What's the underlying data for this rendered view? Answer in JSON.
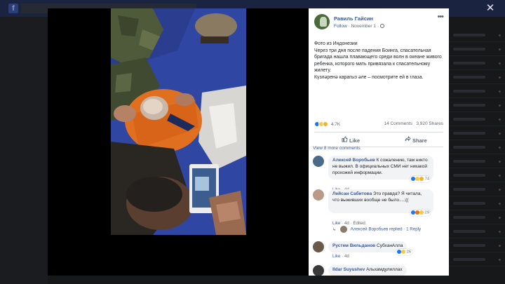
{
  "app": {
    "logo_letter": "f"
  },
  "viewer": {
    "close_glyph": "✕"
  },
  "post": {
    "author": "Равиль Гайсин",
    "follow": "Follow",
    "date": "November 1",
    "separator": "·",
    "more_glyph": "•••",
    "text_lines": [
      "Фото из Индонезии",
      "Через три дня после падения Боинга, спасательная бригада нашла плавающего среди волн в океане живого ребенка, которого мать привязала к спасательному жилету.",
      "Күзләренә карагыз әле – посмотрите ей в глаза."
    ],
    "reactions_count": "4.7K",
    "comments_count": "14 Comments",
    "shares_count": "3,920 Shares",
    "like_label": "Like",
    "share_label": "Share"
  },
  "comments": {
    "view_more": "View 8 more comments",
    "items": [
      {
        "name": "Алексей Воробьев",
        "text": "К сожалению, там никто не выжил. В официальных СМИ нет никакой прохожей информации.",
        "reactions": "74",
        "like": "Like",
        "time": "4d",
        "edited": ""
      },
      {
        "name": "Лейсан Сабитова",
        "text": "Это правда? Я читала, что выживших вообще не было....;((",
        "reactions": "29",
        "like": "Like",
        "time": "4d",
        "edited": "Edited"
      },
      {
        "name": "Рустем Вильданов",
        "text": "СубханАлла",
        "reactions": "26",
        "like": "Like",
        "time": "4d",
        "edited": ""
      },
      {
        "name": "Ildar Suyushev",
        "text": "Альхамдулиллах",
        "reactions": "",
        "like": "",
        "time": "",
        "edited": ""
      }
    ],
    "reply_summary": {
      "arrow": "↳",
      "author": "Алексей Воробьев",
      "verb": "replied",
      "count": "1 Reply"
    }
  },
  "colors": {
    "brand_blue": "#385898",
    "like_blue": "#1877f2",
    "panel_bg": "#ffffff"
  }
}
